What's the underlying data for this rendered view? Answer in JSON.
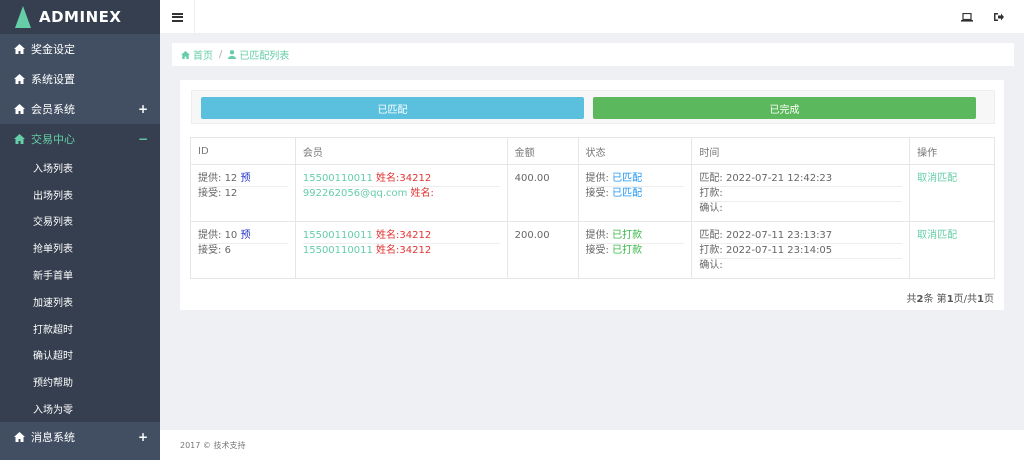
{
  "app": {
    "logo_text": "ADMINEX"
  },
  "sidebar": {
    "items": [
      {
        "label": "奖金设定",
        "icon": "home-icon"
      },
      {
        "label": "系统设置",
        "icon": "home-icon"
      },
      {
        "label": "会员系统",
        "icon": "home-icon",
        "expander": "+"
      },
      {
        "label": "交易中心",
        "icon": "home-icon",
        "expander": "−"
      }
    ],
    "sub_items": [
      "入场列表",
      "出场列表",
      "交易列表",
      "抢单列表",
      "新手首单",
      "加速列表",
      "打款超时",
      "确认超时",
      "预约帮助",
      "入场为零"
    ],
    "bottom_item": {
      "label": "消息系统",
      "expander": "+"
    }
  },
  "breadcrumb": {
    "home": "首页",
    "separator": "/",
    "current": "已匹配列表"
  },
  "buttons": {
    "matched": "已匹配",
    "done": "已完成"
  },
  "table": {
    "headers": [
      "ID",
      "会员",
      "金额",
      "状态",
      "时间",
      "操作"
    ],
    "rows": [
      {
        "provide_label": "提供:",
        "provide_id": "12",
        "provide_tag": "预",
        "accept_label": "接受:",
        "accept_id": "12",
        "member1_phone": "15500110011",
        "member1_name": "姓名:34212",
        "member2_phone": "992262056@qq.com",
        "member2_name": "姓名:",
        "amount": "400.00",
        "status_provide_label": "提供:",
        "status_provide": "已匹配",
        "status_accept_label": "接受:",
        "status_accept": "已匹配",
        "match_label": "匹配:",
        "match_time": "2022-07-21 12:42:23",
        "pay_label": "打款:",
        "pay_time": "",
        "confirm_label": "确认:",
        "confirm_time": "",
        "action": "取消匹配"
      },
      {
        "provide_label": "提供:",
        "provide_id": "10",
        "provide_tag": "预",
        "accept_label": "接受:",
        "accept_id": "6",
        "member1_phone": "15500110011",
        "member1_name": "姓名:34212",
        "member2_phone": "15500110011",
        "member2_name": "姓名:34212",
        "amount": "200.00",
        "status_provide_label": "提供:",
        "status_provide": "已打款",
        "status_accept_label": "接受:",
        "status_accept": "已打款",
        "match_label": "匹配:",
        "match_time": "2022-07-11 23:13:37",
        "pay_label": "打款:",
        "pay_time": "2022-07-11 23:14:05",
        "confirm_label": "确认:",
        "confirm_time": "",
        "action": "取消匹配"
      }
    ]
  },
  "pagination": {
    "prefix": "共",
    "total": "2",
    "mid1": "条 第",
    "page": "1",
    "mid2": "页/共",
    "pages": "1",
    "suffix": "页"
  },
  "footer": {
    "text": "2017 © 技术支持"
  },
  "colors": {
    "sidebar_bg": "#424f63",
    "accent": "#65cea7",
    "info": "#5bc0de",
    "success": "#5cb85c",
    "danger": "#e23434"
  }
}
